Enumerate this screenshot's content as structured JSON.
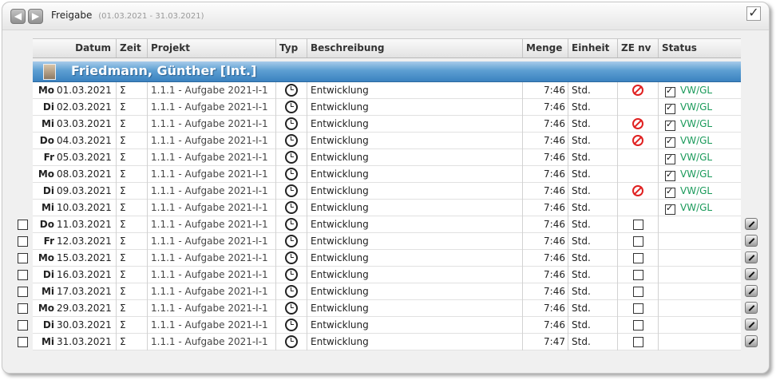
{
  "window": {
    "title": "Freigabe",
    "range": "(01.03.2021 - 31.03.2021)"
  },
  "nav": {
    "prev_icon": "arrow-left-icon",
    "next_icon": "arrow-right-icon"
  },
  "columns": {
    "datum": "Datum",
    "zeit": "Zeit",
    "projekt": "Projekt",
    "typ": "Typ",
    "beschreibung": "Beschreibung",
    "menge": "Menge",
    "einheit": "Einheit",
    "ze_nv": "ZE nv",
    "status": "Status"
  },
  "group": {
    "name": "Friedmann, Günther [Int.]"
  },
  "rows": [
    {
      "dow": "Mo",
      "date": "01.03.2021",
      "zeit": "Σ",
      "projekt": "1.1.1 - Aufgabe 2021-I-1",
      "beschreibung": "Entwicklung",
      "menge": "7:46",
      "einheit": "Std.",
      "ze": "prohibited",
      "status": "VW/GL",
      "select": false
    },
    {
      "dow": "Di",
      "date": "02.03.2021",
      "zeit": "Σ",
      "projekt": "1.1.1 - Aufgabe 2021-I-1",
      "beschreibung": "Entwicklung",
      "menge": "7:46",
      "einheit": "Std.",
      "ze": "",
      "status": "VW/GL",
      "select": false
    },
    {
      "dow": "Mi",
      "date": "03.03.2021",
      "zeit": "Σ",
      "projekt": "1.1.1 - Aufgabe 2021-I-1",
      "beschreibung": "Entwicklung",
      "menge": "7:46",
      "einheit": "Std.",
      "ze": "prohibited",
      "status": "VW/GL",
      "select": false
    },
    {
      "dow": "Do",
      "date": "04.03.2021",
      "zeit": "Σ",
      "projekt": "1.1.1 - Aufgabe 2021-I-1",
      "beschreibung": "Entwicklung",
      "menge": "7:46",
      "einheit": "Std.",
      "ze": "prohibited",
      "status": "VW/GL",
      "select": false
    },
    {
      "dow": "Fr",
      "date": "05.03.2021",
      "zeit": "Σ",
      "projekt": "1.1.1 - Aufgabe 2021-I-1",
      "beschreibung": "Entwicklung",
      "menge": "7:46",
      "einheit": "Std.",
      "ze": "",
      "status": "VW/GL",
      "select": false
    },
    {
      "dow": "Mo",
      "date": "08.03.2021",
      "zeit": "Σ",
      "projekt": "1.1.1 - Aufgabe 2021-I-1",
      "beschreibung": "Entwicklung",
      "menge": "7:46",
      "einheit": "Std.",
      "ze": "",
      "status": "VW/GL",
      "select": false
    },
    {
      "dow": "Di",
      "date": "09.03.2021",
      "zeit": "Σ",
      "projekt": "1.1.1 - Aufgabe 2021-I-1",
      "beschreibung": "Entwicklung",
      "menge": "7:46",
      "einheit": "Std.",
      "ze": "prohibited",
      "status": "VW/GL",
      "select": false
    },
    {
      "dow": "Mi",
      "date": "10.03.2021",
      "zeit": "Σ",
      "projekt": "1.1.1 - Aufgabe 2021-I-1",
      "beschreibung": "Entwicklung",
      "menge": "7:46",
      "einheit": "Std.",
      "ze": "",
      "status": "VW/GL",
      "select": false
    },
    {
      "dow": "Do",
      "date": "11.03.2021",
      "zeit": "Σ",
      "projekt": "1.1.1 - Aufgabe 2021-I-1",
      "beschreibung": "Entwicklung",
      "menge": "7:46",
      "einheit": "Std.",
      "ze": "checkbox",
      "status": "",
      "select": true
    },
    {
      "dow": "Fr",
      "date": "12.03.2021",
      "zeit": "Σ",
      "projekt": "1.1.1 - Aufgabe 2021-I-1",
      "beschreibung": "Entwicklung",
      "menge": "7:46",
      "einheit": "Std.",
      "ze": "checkbox",
      "status": "",
      "select": true
    },
    {
      "dow": "Mo",
      "date": "15.03.2021",
      "zeit": "Σ",
      "projekt": "1.1.1 - Aufgabe 2021-I-1",
      "beschreibung": "Entwicklung",
      "menge": "7:46",
      "einheit": "Std.",
      "ze": "checkbox",
      "status": "",
      "select": true
    },
    {
      "dow": "Di",
      "date": "16.03.2021",
      "zeit": "Σ",
      "projekt": "1.1.1 - Aufgabe 2021-I-1",
      "beschreibung": "Entwicklung",
      "menge": "7:46",
      "einheit": "Std.",
      "ze": "checkbox",
      "status": "",
      "select": true
    },
    {
      "dow": "Mi",
      "date": "17.03.2021",
      "zeit": "Σ",
      "projekt": "1.1.1 - Aufgabe 2021-I-1",
      "beschreibung": "Entwicklung",
      "menge": "7:46",
      "einheit": "Std.",
      "ze": "checkbox",
      "status": "",
      "select": true
    },
    {
      "dow": "Mo",
      "date": "29.03.2021",
      "zeit": "Σ",
      "projekt": "1.1.1 - Aufgabe 2021-I-1",
      "beschreibung": "Entwicklung",
      "menge": "7:46",
      "einheit": "Std.",
      "ze": "checkbox",
      "status": "",
      "select": true
    },
    {
      "dow": "Di",
      "date": "30.03.2021",
      "zeit": "Σ",
      "projekt": "1.1.1 - Aufgabe 2021-I-1",
      "beschreibung": "Entwicklung",
      "menge": "7:46",
      "einheit": "Std.",
      "ze": "checkbox",
      "status": "",
      "select": true
    },
    {
      "dow": "Mi",
      "date": "31.03.2021",
      "zeit": "Σ",
      "projekt": "1.1.1 - Aufgabe 2021-I-1",
      "beschreibung": "Entwicklung",
      "menge": "7:47",
      "einheit": "Std.",
      "ze": "checkbox",
      "status": "",
      "select": true
    }
  ],
  "colors": {
    "status": "#1a9a5a",
    "group_header": "#4a8fc8",
    "prohibited": "#e02020"
  }
}
